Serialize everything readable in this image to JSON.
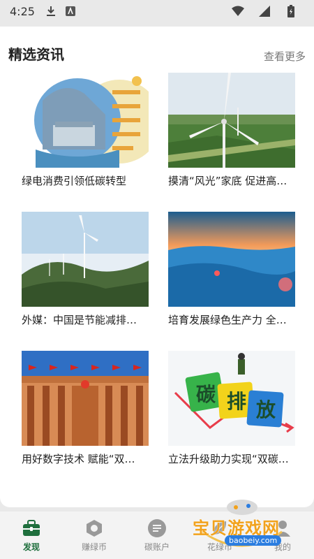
{
  "status_bar": {
    "time": "4:25"
  },
  "section": {
    "title": "精选资讯",
    "see_more": "查看更多"
  },
  "news": [
    {
      "caption": "绿电消费引领低碳转型"
    },
    {
      "caption": "摸清“风光”家底 促进高…"
    },
    {
      "caption": "外媒：中国是节能减排…"
    },
    {
      "caption": "培育发展绿色生产力 全…"
    },
    {
      "caption": "用好数字技术 赋能“双…"
    },
    {
      "caption": "立法升级助力实现“双碳…"
    }
  ],
  "image5_text": [
    "碳",
    "排",
    "放"
  ],
  "nav": [
    {
      "label": "发现",
      "icon": "briefcase-icon",
      "active": true
    },
    {
      "label": "赚绿币",
      "icon": "hexagon-icon",
      "active": false
    },
    {
      "label": "碳账户",
      "icon": "list-circle-icon",
      "active": false
    },
    {
      "label": "花绿币",
      "icon": "leaf-icon",
      "active": false
    },
    {
      "label": "我的",
      "icon": "person-icon",
      "active": false
    }
  ],
  "watermark": {
    "text": "宝贝游戏网",
    "url": "baobeiy.com"
  },
  "colors": {
    "accent": "#1f6f3d",
    "nav_bg": "#f3f3f3",
    "watermark": "#f2a21c"
  }
}
